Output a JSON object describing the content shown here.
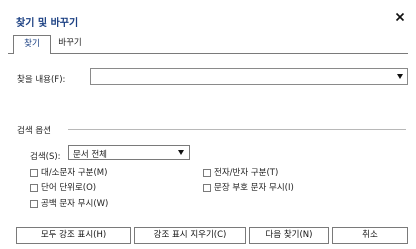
{
  "dialog": {
    "title": "찾기 및 바꾸기",
    "close_icon": "close-icon"
  },
  "tabs": [
    {
      "label": "찾기",
      "active": true
    },
    {
      "label": "바꾸기",
      "active": false
    }
  ],
  "find": {
    "label": "찾을 내용(F):",
    "value": ""
  },
  "options": {
    "title": "검색 옵션",
    "search_label": "검색(S):",
    "search_value": "문서 전체",
    "checkboxes": [
      {
        "label": "대/소문자 구분(M)",
        "checked": false
      },
      {
        "label": "단어 단위로(O)",
        "checked": false
      },
      {
        "label": "공백 문자 무시(W)",
        "checked": false
      },
      {
        "label": "전자/반자 구분(T)",
        "checked": false
      },
      {
        "label": "문장 부호 문자 무시(I)",
        "checked": false
      }
    ]
  },
  "buttons": {
    "highlight_all": "모두 강조 표시(H)",
    "clear_highlight": "강조 표시 지우기(C)",
    "find_next": "다음 찾기(N)",
    "cancel": "취소"
  },
  "colors": {
    "title": "#1a3f82",
    "border": "#7a7a7a"
  }
}
